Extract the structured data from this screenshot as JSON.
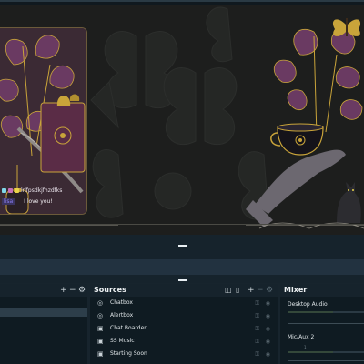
{
  "preview": {
    "chat": {
      "username_highlight": "lisa",
      "username_rest": "lrlfpsdkjfhzdfks",
      "message": "I love you!"
    }
  },
  "scenes_dock": {
    "title": "",
    "toolbar": {
      "add": "+",
      "remove": "−",
      "settings": "⚙"
    }
  },
  "sources_dock": {
    "title": "Sources",
    "toolbar": {
      "add": "+",
      "remove": "−",
      "settings": "⚙"
    },
    "items": [
      {
        "label": "Chatbox",
        "icon": "browser-icon"
      },
      {
        "label": "Alertbox",
        "icon": "browser-icon"
      },
      {
        "label": "Chat Boarder",
        "icon": "image-icon"
      },
      {
        "label": "SS Music",
        "icon": "image-icon"
      },
      {
        "label": "Starting Soon",
        "icon": "image-icon"
      }
    ]
  },
  "mixer_dock": {
    "title": "Mixer",
    "channels": [
      {
        "name": "Desktop Audio",
        "level": 0.6
      },
      {
        "name": "Mic/Aux 2",
        "level": 0.6
      }
    ],
    "scale_mark": "1"
  },
  "colors": {
    "accent_gold": "#c9a43a",
    "accent_purple": "#7a4a78",
    "panel_bg": "#0f1b22",
    "header_bg": "#16232c"
  }
}
